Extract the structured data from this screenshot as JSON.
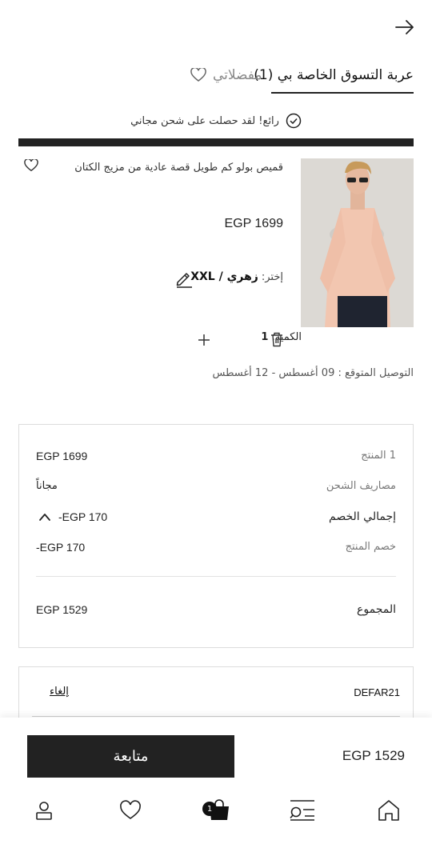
{
  "header": {
    "cart_tab": "عربة التسوق الخاصة بي (1)",
    "favorites_tab": "مفضلاتي"
  },
  "shipping_notice": "رائع! لقد حصلت على شحن مجاني",
  "product": {
    "title": "قميص بولو كم طويل قصة عادية من مزيج الكتان",
    "price": "EGP 1699",
    "variant_label": "إختر:",
    "variant_value": "زهري / XXL",
    "quantity_label": "الكمية:",
    "quantity": "1",
    "delivery": "التوصيل المتوقع : 09 أغسطس - 12 أغسطس"
  },
  "summary": {
    "items_label": "1 المنتج",
    "items_value": "EGP 1699",
    "shipping_label": "مصاريف الشحن",
    "shipping_value": "مجاناً",
    "discount_total_label": "إجمالي الخصم",
    "discount_total_value": "-EGP 170",
    "product_discount_label": "خصم المنتج",
    "product_discount_value": "-EGP 170",
    "total_label": "المجموع",
    "total_value": "EGP 1529"
  },
  "coupon": {
    "code": "DEFAR21",
    "cancel": "إلغاء"
  },
  "checkout": {
    "continue": "متابعة",
    "total": "EGP 1529"
  },
  "nav": {
    "cart_badge": "1",
    "icons": [
      "profile-icon",
      "heart-icon",
      "cart-icon",
      "search-icon",
      "home-icon"
    ]
  },
  "colors": {
    "primary": "#222222",
    "muted": "#888888"
  }
}
